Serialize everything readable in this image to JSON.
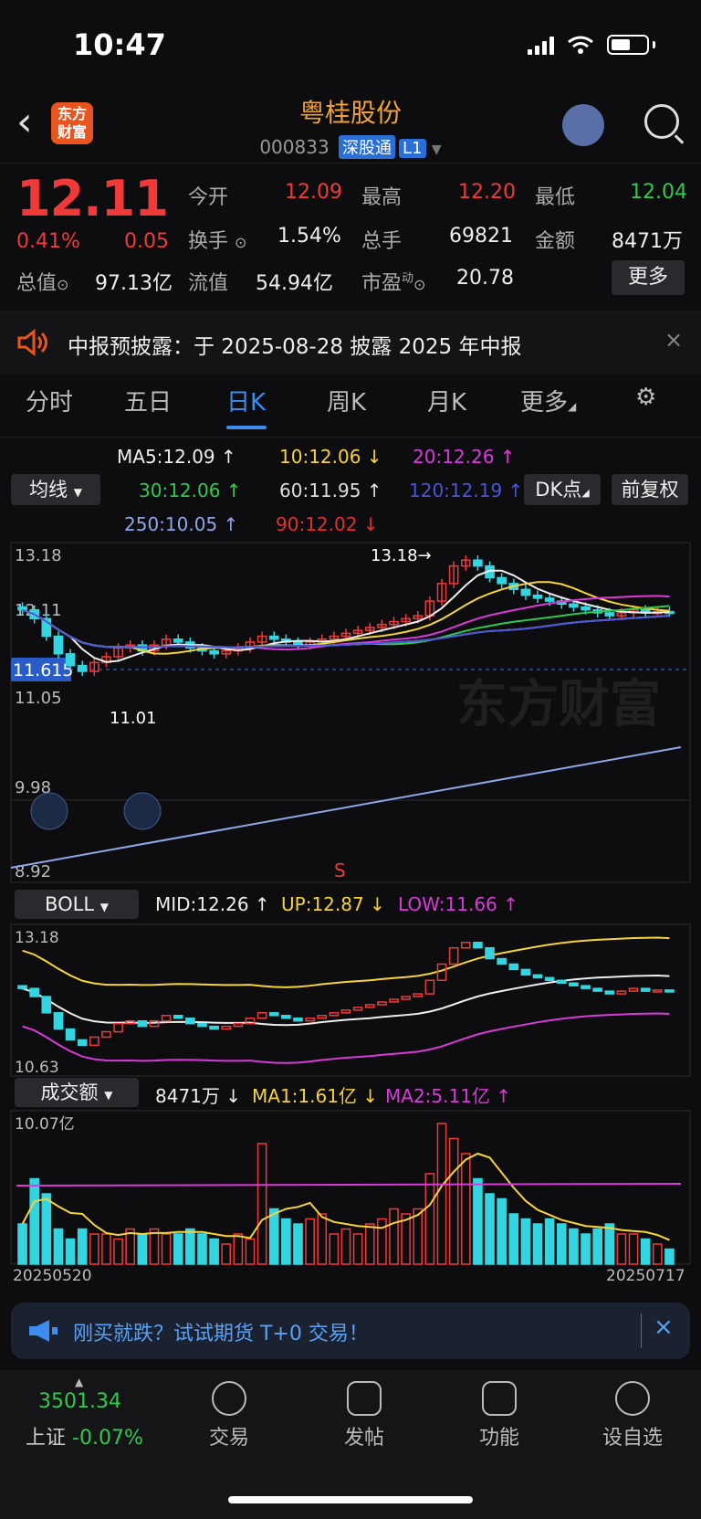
{
  "status": {
    "time": "10:47"
  },
  "header": {
    "logo_text_1": "东方",
    "logo_text_2": "财富",
    "stock_name": "粤桂股份",
    "stock_code": "000833",
    "market_tag": "深股通",
    "level_tag": "L1"
  },
  "quote": {
    "price": "12.11",
    "change_pct": "0.41%",
    "change": "0.05",
    "open_label": "今开",
    "open": "12.09",
    "high_label": "最高",
    "high": "12.20",
    "low_label": "最低",
    "low": "12.04",
    "turnover_label": "换手",
    "turnover": "1.54%",
    "volume_label": "总手",
    "volume": "69821",
    "amount_label": "金额",
    "amount": "8471万",
    "mktcap_label": "总值",
    "mktcap": "97.13亿",
    "float_label": "流值",
    "float": "54.94亿",
    "pe_label": "市盈",
    "pe_sup": "动",
    "pe": "20.78",
    "more_label": "更多"
  },
  "notice": {
    "text": "中报预披露：于 2025-08-28 披露 2025 年中报"
  },
  "tabs": [
    "分时",
    "五日",
    "日K",
    "周K",
    "月K",
    "更多"
  ],
  "kline": {
    "ma_selector": "均线",
    "ma5": "MA5:12.09 ↑",
    "ma10": "10:12.06 ↓",
    "ma20": "20:12.26 ↑",
    "ma30": "30:12.06 ↑",
    "ma60": "60:11.95 ↑",
    "ma120": "120:12.19 ↑",
    "ma250": "250:10.05 ↑",
    "ma90": "90:12.02 ↓",
    "dk_label": "DK点",
    "adj_label": "前复权",
    "y_high": "13.18",
    "y_mid": "12.11",
    "cur_price_tag": "11.615",
    "y_low1": "11.05",
    "y_low2": "9.98",
    "y_low3": "8.92",
    "max_label": "13.18→",
    "min_label": "11.01",
    "watermark": "东方财富",
    "s_marker": "S"
  },
  "boll": {
    "selector": "BOLL",
    "mid": "MID:12.26 ↑",
    "up": "UP:12.87 ↓",
    "low": "LOW:11.66 ↑",
    "y_top": "13.18",
    "y_bottom": "10.63"
  },
  "volume": {
    "selector": "成交额",
    "value": "8471万 ↓",
    "ma1": "MA1:1.61亿 ↓",
    "ma2": "MA2:5.11亿 ↑",
    "y_top": "10.07亿",
    "date_start": "20250520",
    "date_end": "20250717"
  },
  "banner": {
    "text": "刚买就跌？试试期货 T+0 交易！"
  },
  "bottom_nav": {
    "index_value": "3501.34",
    "index_name": "上证",
    "index_change": "-0.07%",
    "items": [
      "交易",
      "发帖",
      "功能",
      "设自选"
    ]
  },
  "colors": {
    "up": "#f03a3a",
    "down": "#33d6e0",
    "accent": "#3d8cf0",
    "brand": "#e9541f"
  }
}
